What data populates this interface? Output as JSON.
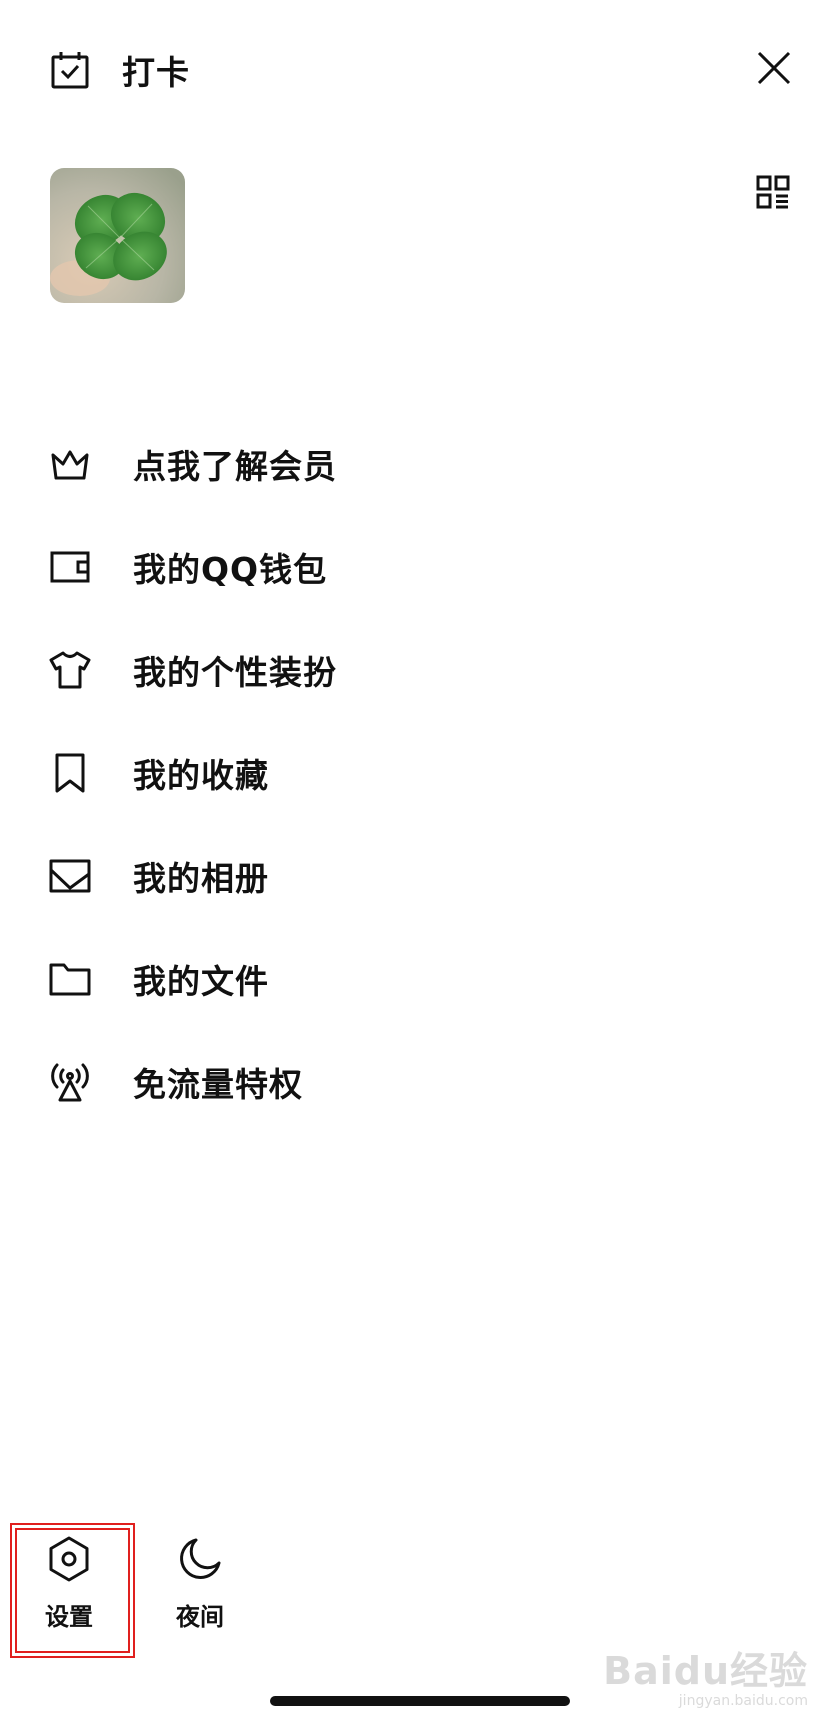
{
  "header": {
    "checkin_label": "打卡"
  },
  "menu": {
    "items": [
      {
        "label": "点我了解会员",
        "icon": "crown-icon"
      },
      {
        "label": "我的QQ钱包",
        "icon": "wallet-icon"
      },
      {
        "label": "我的个性装扮",
        "icon": "tshirt-icon"
      },
      {
        "label": "我的收藏",
        "icon": "bookmark-icon"
      },
      {
        "label": "我的相册",
        "icon": "photo-icon"
      },
      {
        "label": "我的文件",
        "icon": "folder-icon"
      },
      {
        "label": "免流量特权",
        "icon": "signal-tower-icon"
      }
    ]
  },
  "bottom": {
    "settings_label": "设置",
    "night_label": "夜间"
  },
  "watermark": {
    "text": "Baidu经验",
    "sub": "jingyan.baidu.com"
  },
  "colors": {
    "text": "#111111",
    "highlight": "#e0201e",
    "background": "#ffffff"
  }
}
